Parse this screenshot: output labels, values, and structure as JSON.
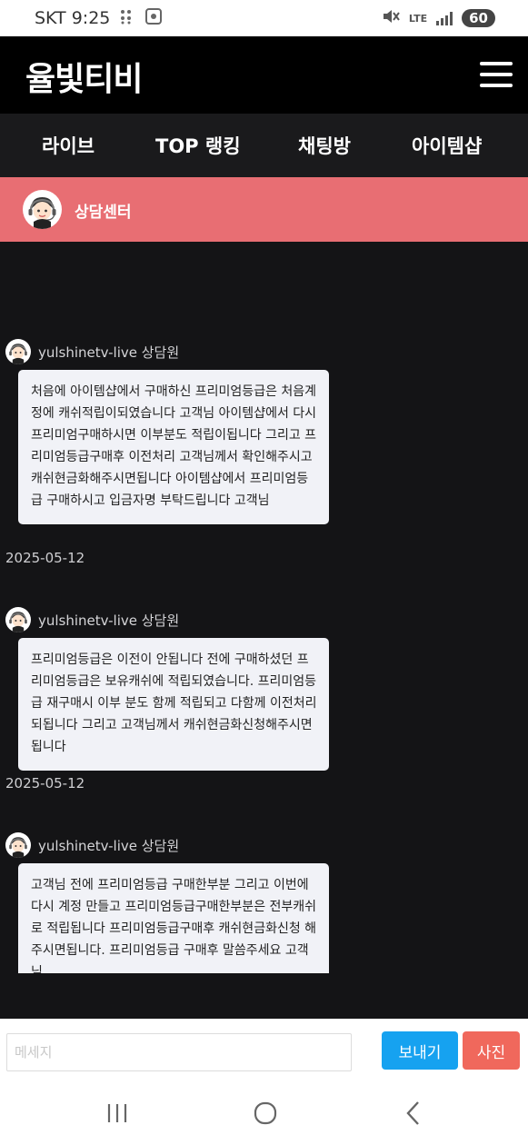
{
  "status_bar": {
    "carrier": "SKT",
    "time": "9:25",
    "network": "LTE",
    "battery": "60"
  },
  "header": {
    "title": "율빛티비"
  },
  "nav": {
    "items": [
      "라이브",
      "TOP 랭킹",
      "채팅방",
      "아이템샵"
    ]
  },
  "banner": {
    "title": "상담센터"
  },
  "messages": [
    {
      "sender": "yulshinetv-live 상담원",
      "text": "처음에 아이템샵에서 구매하신 프리미엄등급은 처음계정에 캐쉬적립이되였습니다 고객님 아이템샵에서 다시 프리미엄구매하시면 이부분도 적립이됩니다 그리고 프리미엄등급구매후 이전처리 고객님께서 확인해주시고 캐쉬현금화해주시면됩니다 아이템샵에서 프리미엄등급 구매하시고 입금자명 부탁드립니다 고객님",
      "date": "2025-05-12"
    },
    {
      "sender": "yulshinetv-live 상담원",
      "text": "프리미엄등급은 이전이 안됩니다 전에 구매하셨던 프리미엄등급은 보유캐쉬에 적립되였습니다. 프리미엄등급 재구매시 이부 분도 함께 적립되고 다함께 이전처리되됩니다 그리고 고객님께서 캐쉬현금화신청해주시면됩니다",
      "date": "2025-05-12"
    },
    {
      "sender": "yulshinetv-live 상담원",
      "text": "고객님 전에 프리미엄등급 구매한부분 그리고 이번에 다시 계정 만들고 프리미엄등급구매한부분은 전부캐쉬로 적립됩니다 프리미엄등급구매후 캐쉬현금화신청 해주시면됩니다. 프리미엄등급 구매후 말씀주세요 고객님"
    }
  ],
  "composer": {
    "placeholder": "메세지",
    "value": "",
    "send_label": "보내기",
    "photo_label": "사진"
  },
  "colors": {
    "banner": "#e86e73",
    "send": "#16a2f0",
    "photo": "#f0685c",
    "chat_bg": "#141416"
  },
  "icons": {
    "menu": "hamburger-menu-icon",
    "recent": "recent-apps-icon",
    "home": "home-icon",
    "back": "back-icon"
  }
}
